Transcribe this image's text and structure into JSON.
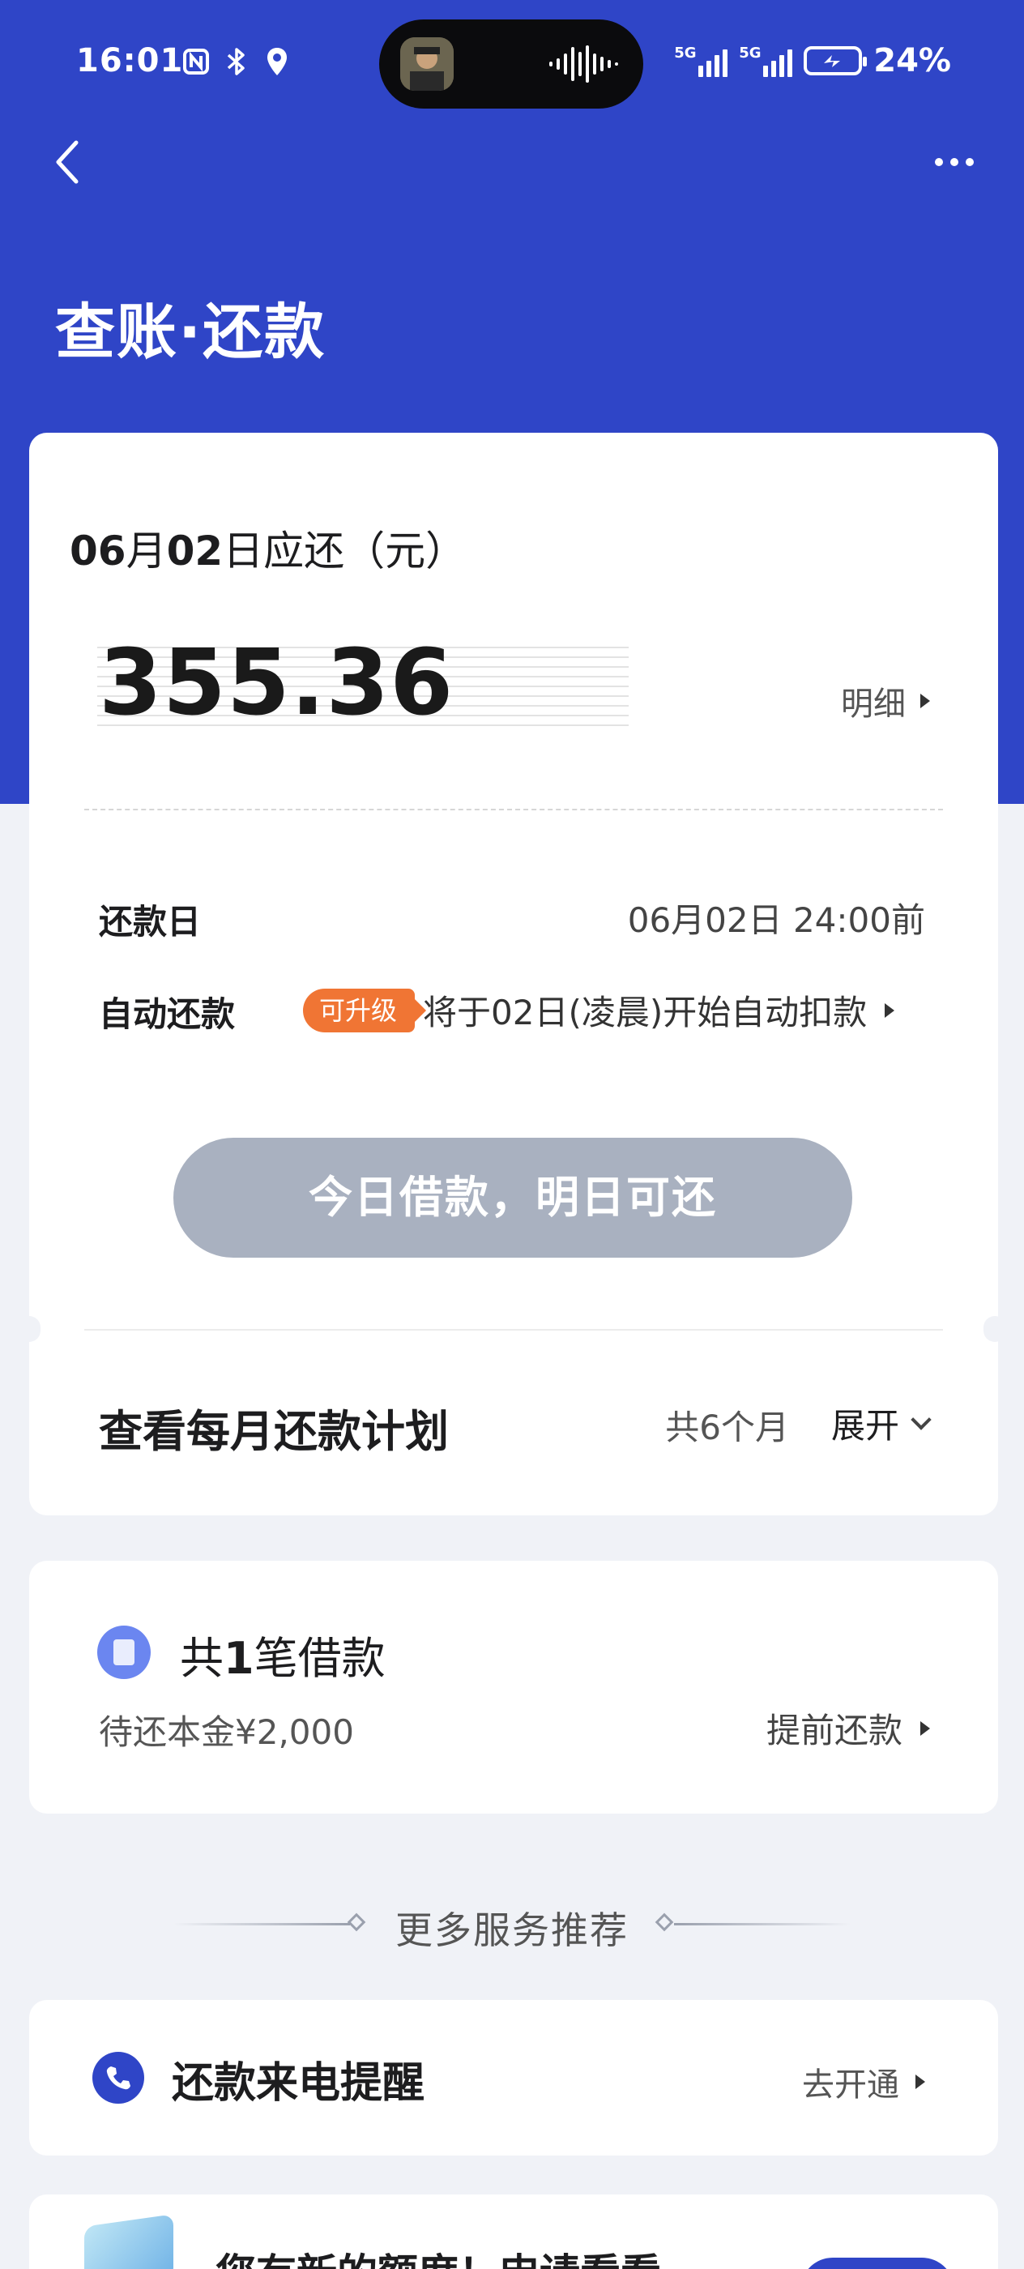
{
  "status_bar": {
    "time": "16:01",
    "left_icons": [
      "nfc-icon",
      "bluetooth-icon",
      "location-icon"
    ],
    "signal_1": "5G",
    "signal_2": "5G",
    "battery_percent": "24%",
    "battery_level": 0.24
  },
  "nav": {
    "title": "查账·还款",
    "back_icon": "chevron-left-icon",
    "more_icon": "more-horizontal-icon"
  },
  "bill": {
    "due_month": "06",
    "due_month_unit": "月",
    "due_day": "02",
    "due_suffix": "日应还（元）",
    "amount": "355.36",
    "detail_link": "明细",
    "repay_day_label": "还款日",
    "repay_day_value": "06月02日 24:00前",
    "auto_repay_label": "自动还款",
    "upgrade_badge": "可升级",
    "auto_repay_value": "将于02日(凌晨)开始自动扣款",
    "action_button": "今日借款，明日可还",
    "plan_label": "查看每月还款计划",
    "plan_count": "共6个月",
    "plan_expand": "展开"
  },
  "loans": {
    "title_prefix": "共",
    "count": "1",
    "title_suffix": "笔借款",
    "principal": "待还本金¥2,000",
    "prepay_link": "提前还款"
  },
  "more_services": {
    "section_title": "更多服务推荐",
    "phone_reminder": {
      "label": "还款来电提醒",
      "action": "去开通"
    },
    "quota": {
      "label": "您有新的额度！申请看看"
    }
  },
  "colors": {
    "brand_blue": "#2f45c7",
    "badge_orange": "#f07534",
    "disabled_button": "#a9b1c0",
    "background": "#f0f2f7"
  }
}
